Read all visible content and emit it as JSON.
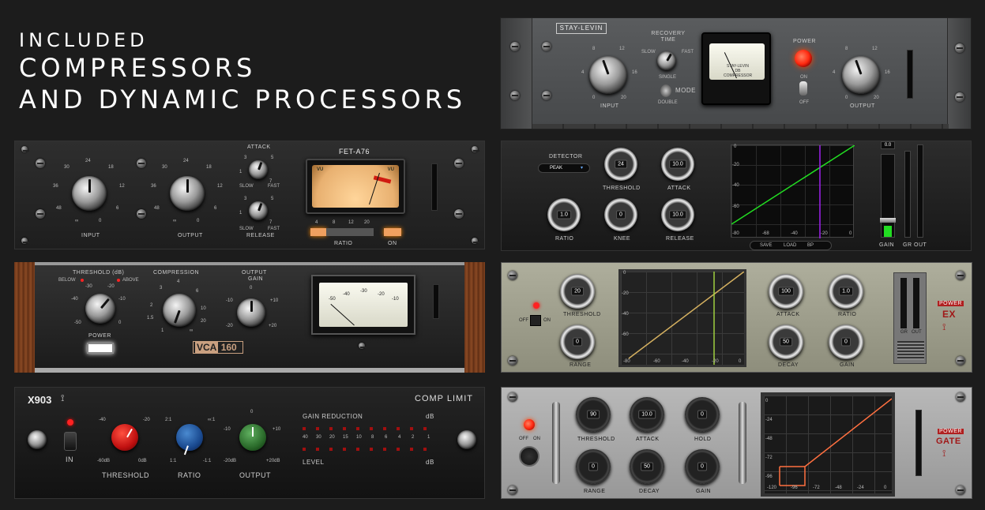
{
  "headline": {
    "line1": "INCLUDED",
    "line2": "COMPRESSORS",
    "line3": "AND DYNAMIC PROCESSORS"
  },
  "colors": {
    "background": "#1c1c1c",
    "fet_amber": "#e8b070",
    "vca_wood": "#7a3d1c",
    "power_red": "#ff2a10",
    "graph_green": "#22dd22",
    "graph_purple": "#a020f0",
    "graph_gold": "#d4b060",
    "graph_orange": "#ff7040"
  },
  "stay_levin": {
    "brand": "STAY-LEVIN",
    "recovery_label": "RECOVERY TIME",
    "slow": "SLOW",
    "fast": "FAST",
    "single": "SINGLE",
    "double": "DOUBLE",
    "mode": "MODE",
    "input_label": "INPUT",
    "output_label": "OUTPUT",
    "power_label": "POWER",
    "on": "ON",
    "off": "OFF",
    "meter_text": "STAY-LEVIN DB COMPRESSOR",
    "scale": {
      "s0": "0",
      "s4": "4",
      "s8": "8",
      "s12": "12",
      "s16": "16",
      "s20": "20"
    }
  },
  "fet": {
    "title": "FET-A76",
    "input_label": "INPUT",
    "output_label": "OUTPUT",
    "attack_label": "ATTACK",
    "release_label": "RELEASE",
    "slow": "SLOW",
    "fast": "FAST",
    "ratio_label": "RATIO",
    "on_label": "ON",
    "ratios": [
      "4",
      "8",
      "12",
      "20"
    ],
    "vu": "VU",
    "scale": {
      "a": "24",
      "b": "30",
      "c": "18",
      "d": "36",
      "e": "12",
      "f": "48",
      "g": "6",
      "h": "∞",
      "i": "0"
    },
    "attack_scale": {
      "a": "3",
      "b": "5",
      "c": "1",
      "d": "7"
    }
  },
  "dyn": {
    "detector_label": "DETECTOR",
    "detector_value": "PEAK",
    "threshold_label": "THRESHOLD",
    "threshold_value": "24",
    "attack_label": "ATTACK",
    "attack_value": "10.0",
    "ratio_label": "RATIO",
    "ratio_value": "1.0",
    "knee_label": "KNEE",
    "knee_value": "0",
    "release_label": "RELEASE",
    "release_value": "10.0",
    "save": "SAVE",
    "load": "LOAD",
    "bp": "BP",
    "gain_label": "GAIN",
    "gr_label": "GR",
    "out_label": "OUT",
    "meter_value": "0.0",
    "graph_ticks_y": [
      "0",
      "-20",
      "-40",
      "-60",
      "-80"
    ],
    "graph_ticks_x": [
      "-80",
      "-68",
      "-40",
      "-20",
      "0"
    ]
  },
  "vca": {
    "threshold_label": "THRESHOLD (dB)",
    "below": "BELOW",
    "above": "ABOVE",
    "compression_label": "COMPRESSION",
    "output_label": "OUTPUT",
    "gain_label": "GAIN",
    "power_label": "POWER",
    "model": "VCA",
    "model_num": "160",
    "vu_scale": [
      "-50",
      "-40",
      "-30",
      "-20",
      "-10"
    ],
    "t_scale": {
      "a": "-30",
      "b": "-20",
      "c": "-40",
      "d": "-10",
      "e": "-50",
      "f": "0"
    },
    "c_scale": {
      "a": "3",
      "b": "4",
      "c": "6",
      "d": "2",
      "e": "10",
      "f": "1.5",
      "g": "20",
      "h": "1",
      "i": "∞"
    },
    "o_scale": {
      "a": "0",
      "b": "-10",
      "c": "+10",
      "d": "-20",
      "e": "+20"
    }
  },
  "exp": {
    "threshold_label": "THRESHOLD",
    "threshold_value": "20",
    "range_label": "RANGE",
    "range_value": "0",
    "attack_label": "ATTACK",
    "attack_value": "100",
    "ratio_label": "RATIO",
    "ratio_value": "1.0",
    "decay_label": "DECAY",
    "decay_value": "50",
    "gain_label": "GAIN",
    "gain_value": "0",
    "off": "OFF",
    "on": "ON",
    "brand_top": "POWER",
    "brand": "EX",
    "gr_label": "GR",
    "out_label": "OUT",
    "graph_ticks_y": [
      "0",
      "-20",
      "-40",
      "-60",
      "-80"
    ],
    "graph_ticks_x": [
      "-80",
      "-60",
      "-40",
      "-20",
      "0"
    ]
  },
  "x903": {
    "brand": "X903",
    "title": "COMP LIMIT",
    "in_label": "IN",
    "threshold_label": "THRESHOLD",
    "ratio_label": "RATIO",
    "output_label": "OUTPUT",
    "gain_reduction_label": "GAIN REDUCTION",
    "level_label": "LEVEL",
    "db": "dB",
    "gr_values": [
      "40",
      "30",
      "20",
      "15",
      "10",
      "8",
      "6",
      "4",
      "2",
      "1"
    ],
    "t_scale": {
      "a": "-40",
      "b": "-20",
      "c": "-60dB",
      "d": "0dB"
    },
    "r_scale": {
      "a": "2:1",
      "b": "∞:1",
      "c": "1:1",
      "d": "-1:1"
    },
    "o_scale": {
      "a": "0",
      "b": "-10",
      "c": "+10",
      "d": "-20dB",
      "e": "+20dB"
    }
  },
  "gate": {
    "threshold_label": "THRESHOLD",
    "threshold_value": "90",
    "attack_label": "ATTACK",
    "attack_value": "10.0",
    "hold_label": "HOLD",
    "hold_value": "0",
    "range_label": "RANGE",
    "range_value": "0",
    "decay_label": "DECAY",
    "decay_value": "50",
    "gain_label": "GAIN",
    "gain_value": "0",
    "off": "OFF",
    "on": "ON",
    "brand_top": "POWER",
    "brand": "GATE",
    "graph_ticks_y": [
      "0",
      "-24",
      "-48",
      "-72",
      "-96"
    ],
    "graph_ticks_x": [
      "-120",
      "-96",
      "-72",
      "-48",
      "-24",
      "0"
    ]
  }
}
